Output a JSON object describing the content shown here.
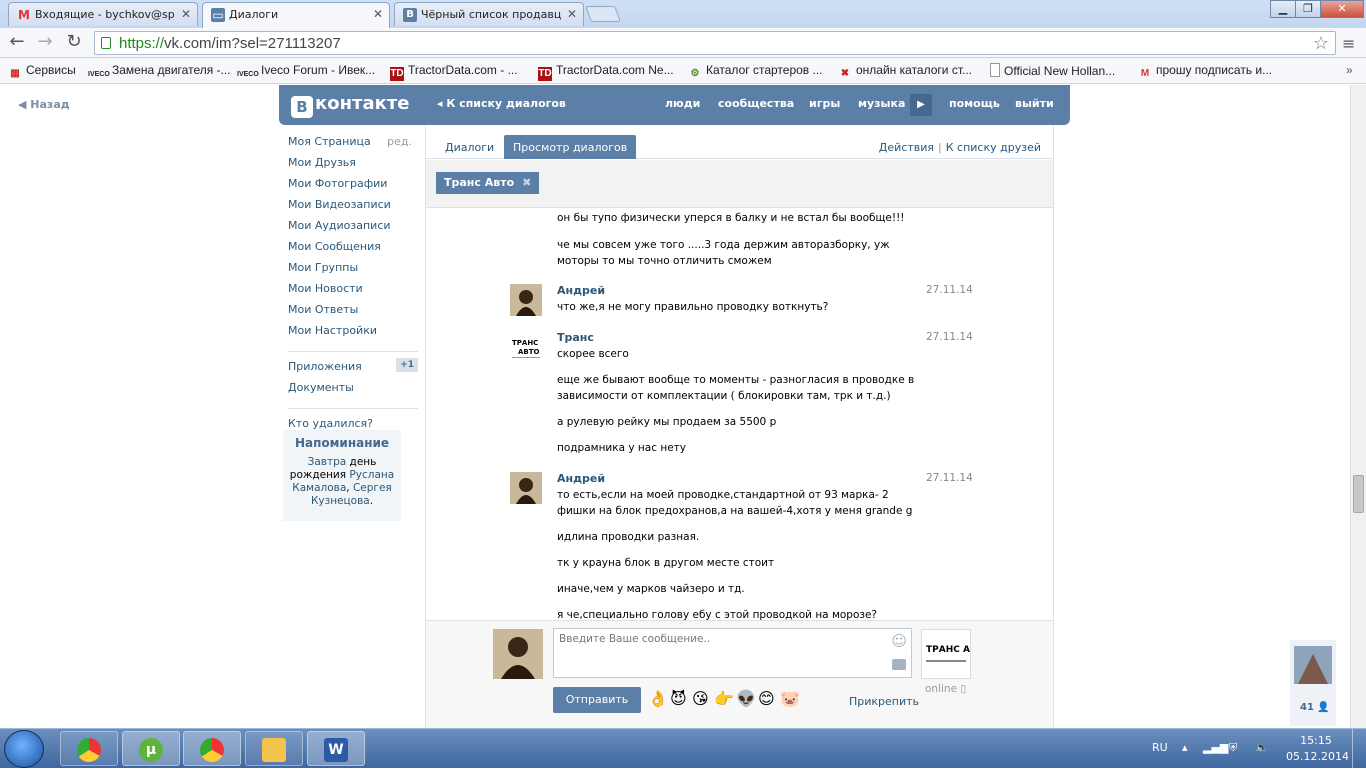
{
  "browser": {
    "tabs": [
      {
        "icon": "gmail-icon",
        "label": "Входящие - bychkov@sp"
      },
      {
        "icon": "vk-icon",
        "label": "Диалоги"
      },
      {
        "icon": "vk-icon",
        "label": "Чёрный список продавц"
      }
    ],
    "url_https": "https://",
    "url_rest": "vk.com/im?sel=271113207",
    "bookmarks": [
      {
        "icon": "apps-grid-icon",
        "label": "Сервисы"
      },
      {
        "icon": "iveco-icon",
        "label": "Замена двигателя -..."
      },
      {
        "icon": "iveco-icon",
        "label": "Iveco Forum - Ивек..."
      },
      {
        "icon": "td-icon",
        "label": "TractorData.com - ..."
      },
      {
        "icon": "td-icon",
        "label": "TractorData.com Ne..."
      },
      {
        "icon": "gear-icon",
        "label": "Каталог стартеров ..."
      },
      {
        "icon": "catalog-icon",
        "label": "онлайн каталоги ст..."
      },
      {
        "icon": "page-icon",
        "label": "Official New Hollan..."
      },
      {
        "icon": "gmail-icon",
        "label": "прошу подписать и..."
      }
    ]
  },
  "vk": {
    "back": "Назад",
    "logo": "контакте",
    "logo_letter": "В",
    "header_back": "К списку диалогов",
    "nav": [
      "люди",
      "сообщества",
      "игры",
      "музыка",
      "помощь",
      "выйти"
    ],
    "left_menu": [
      {
        "label": "Моя Страница",
        "extra": "ред."
      },
      {
        "label": "Мои Друзья"
      },
      {
        "label": "Мои Фотографии"
      },
      {
        "label": "Мои Видеозаписи"
      },
      {
        "label": "Мои Аудиозаписи"
      },
      {
        "label": "Мои Сообщения"
      },
      {
        "label": "Мои Группы"
      },
      {
        "label": "Мои Новости"
      },
      {
        "label": "Мои Ответы"
      },
      {
        "label": "Мои Настройки"
      }
    ],
    "apps": {
      "label": "Приложения",
      "badge": "+1"
    },
    "docs": "Документы",
    "who_deleted": "Кто удалился?",
    "reminder": {
      "title": "Напоминание",
      "w1": "Завтра",
      "w2": " день рождения ",
      "n1": "Руслана Камалова",
      "w3": ", ",
      "n2": "Сергея Кузнецова",
      "w4": "."
    },
    "tabs": {
      "dialogs": "Диалоги",
      "view": "Просмотр диалогов"
    },
    "links": {
      "actions": "Действия",
      "sep": "|",
      "friends": "К списку друзей"
    },
    "peer": "Транс Авто",
    "messages": {
      "m0a": "он бы тупо физически уперся в балку и не встал бы вообще!!!",
      "m0b": "че мы совсем уже того .....3 года держим авторазборку, уж моторы то мы точно отличить сможем",
      "a1": "Андрей",
      "d1": "27.11.14",
      "m1": "что же,я не могу правильно проводку воткнуть?",
      "a2": "Транс",
      "d2": "27.11.14",
      "m2a": "скорее всего",
      "m2b": "еще же бывают вообще то моменты - разногласия в проводке в зависимости от комплектации ( блокировки там, трк и т.д.)",
      "m2c": "а рулевую рейку мы продаем за 5500 р",
      "m2d": "подрамника у нас нету",
      "a3": "Андрей",
      "d3": "27.11.14",
      "m3a": "то есть,если на моей проводке,стандартной от 93 марка- 2 фишки на блок предохранов,а на вашей-4,хотя у меня grande g",
      "m3b": "идлина проводки разная.",
      "m3c": "тк у крауна блок в другом месте стоит",
      "m3d": "иначе,чем у марков чайзеро и тд.",
      "m3e": "я че,специально голову ебу с этой проводкой на морозе?"
    },
    "composer": {
      "placeholder": "Введите Ваше сообщение..",
      "send": "Отправить",
      "attach": "Прикрепить",
      "online": "online",
      "emoji": [
        "👌",
        "😈",
        "😘",
        "👉",
        "👽",
        "😊",
        "🐷"
      ]
    },
    "peer_logo": "ТРАНС АВТО",
    "side_count": "41"
  },
  "taskbar": {
    "lang": "RU",
    "time": "15:15",
    "date": "05.12.2014"
  }
}
